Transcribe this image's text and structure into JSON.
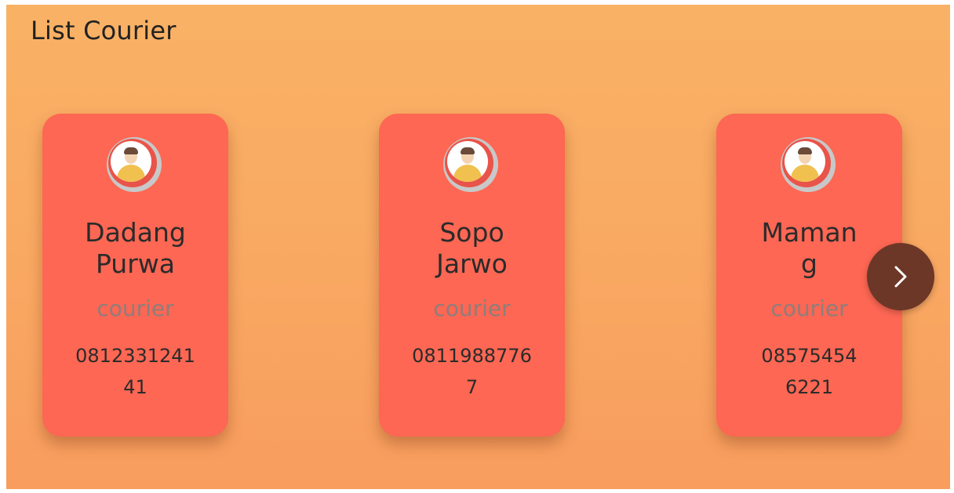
{
  "header": {
    "title": "List Courier"
  },
  "couriers": [
    {
      "name": "Dadang\nPurwa",
      "role": "courier",
      "phone": "0812331241\n41"
    },
    {
      "name": "Sopo\nJarwo",
      "role": "courier",
      "phone": "0811988776\n7"
    },
    {
      "name": "Maman\ng",
      "role": "courier",
      "phone": "08575454\n6221"
    }
  ],
  "carousel": {
    "next_icon": "chevron-right-icon"
  },
  "colors": {
    "background_top": "#f9b265",
    "background_bottom": "#f89d5e",
    "card": "#fd6753",
    "role_text": "#8f7d7b",
    "next_button": "#6d3727"
  }
}
